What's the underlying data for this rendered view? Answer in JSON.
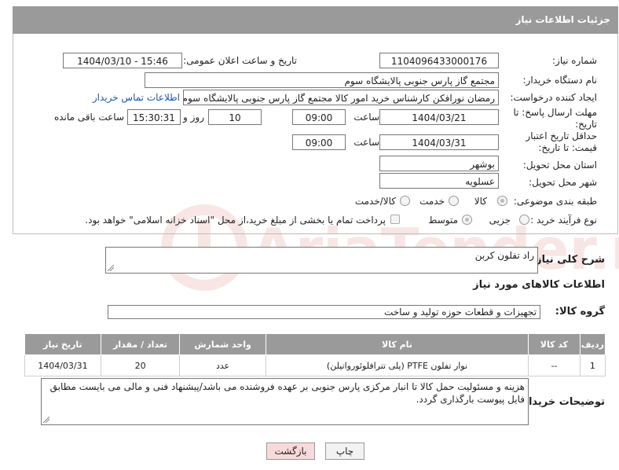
{
  "header": {
    "title": "جزئیات اطلاعات نیاز"
  },
  "form": {
    "need_number_label": "شماره نیاز:",
    "need_number": "1104096433000176",
    "announce_label": "تاریخ و ساعت اعلان عمومی:",
    "announce_value": "1404/03/10 - 15:46",
    "buyer_org_label": "نام دستگاه خریدار:",
    "buyer_org": "مجتمع گاز پارس جنوبی  پالایشگاه سوم",
    "creator_label": "ایجاد کننده درخواست:",
    "creator": "رمضان نورافکن کارشناس خرید امور کالا مجتمع گاز پارس جنوبی  پالایشگاه سوم",
    "contact_link": "اطلاعات تماس خریدار",
    "deadline_label": "مهلت ارسال پاسخ: تا تاریخ:",
    "deadline_date": "1404/03/21",
    "time_label": "ساعت",
    "deadline_time": "09:00",
    "day_label": "روز و",
    "days": "10",
    "remaining_time": "15:30:31",
    "remaining_label": "ساعت باقی مانده",
    "validity_label": "حداقل تاریخ اعتبار قیمت: تا تاریخ:",
    "validity_date": "1404/03/31",
    "validity_time": "09:00",
    "province_label": "استان محل تحویل:",
    "province": "بوشهر",
    "city_label": "شهر محل تحویل:",
    "city": "عسلویه",
    "category_label": "طبقه بندی موضوعی:",
    "category_options": [
      "کالا",
      "خدمت",
      "کالا/خدمت"
    ],
    "process_label": "نوع فرآیند خرید :",
    "process_options": [
      "جزیی",
      "متوسط"
    ],
    "payment_note": "پرداخت تمام یا بخشی از مبلغ خرید،از محل \"اسناد خزانه اسلامی\" خواهد بود."
  },
  "description": {
    "label": "شرح کلی نیاز:",
    "value": "راد تفلون کربن"
  },
  "goods": {
    "title": "اطلاعات کالاهای مورد نیاز",
    "group_label": "گروه کالا:",
    "group_value": "تجهیزات و قطعات حوزه تولید و ساخت",
    "columns": [
      "ردیف",
      "کد کالا",
      "نام کالا",
      "واحد شمارش",
      "تعداد / مقدار",
      "تاریخ نیاز"
    ],
    "rows": [
      [
        "1",
        "--",
        "نوار تفلون PTFE (پلی تترافلوئورواتیلن)",
        "عدد",
        "20",
        "1404/03/31"
      ]
    ]
  },
  "buyer_notes": {
    "label": "توضیحات خریدار:",
    "value": "هزینه و مسئولیت حمل کالا تا انبار مرکزی پارس جنوبی بر عهده فروشنده می باشد/پیشنهاد فنی و مالی می بایست مطابق فایل پیوست بارگذاری گردد."
  },
  "buttons": {
    "print": "چاپ",
    "back": "بازگشت"
  },
  "watermark": {
    "text": "AriaTender.neT"
  },
  "colors": {
    "header_bg": "#9a9a9a",
    "link": "#1a56b5",
    "back_button_bg": "#f9dada"
  }
}
